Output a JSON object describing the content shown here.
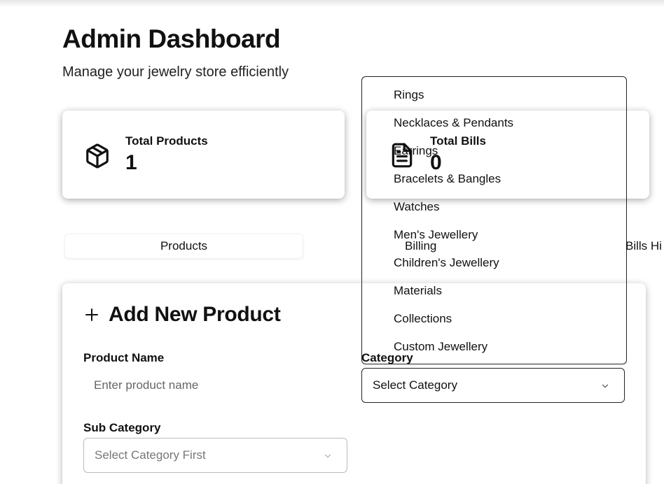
{
  "header": {
    "title": "Admin Dashboard",
    "subtitle": "Manage your jewelry store efficiently"
  },
  "stats": [
    {
      "label": "Total Products",
      "value": "1",
      "icon": "package-icon"
    },
    {
      "label": "Total Bills",
      "value": "0",
      "icon": "document-icon"
    }
  ],
  "tabs": [
    {
      "label": "Products",
      "active": true
    },
    {
      "label": "Billing",
      "active": false
    },
    {
      "label": "Bills Hi",
      "active": false
    }
  ],
  "form": {
    "title": "Add New Product",
    "title_icon": "plus-icon",
    "product_name": {
      "label": "Product Name",
      "placeholder": "Enter product name",
      "value": ""
    },
    "category": {
      "label": "Category",
      "selected": "Select Category",
      "icon": "chevron-down-icon"
    },
    "sub_category": {
      "label": "Sub Category",
      "selected": "Select Category First",
      "icon": "chevron-down-icon"
    }
  },
  "category_options": [
    "Rings",
    "Necklaces & Pendants",
    "Earrings",
    "Bracelets & Bangles",
    "Watches",
    "Men's Jewellery",
    "Children's Jewellery",
    "Materials",
    "Collections",
    "Custom Jewellery"
  ],
  "colors": {
    "text": "#111111",
    "muted_text": "#777777",
    "border": "#222222",
    "background": "#ffffff"
  }
}
